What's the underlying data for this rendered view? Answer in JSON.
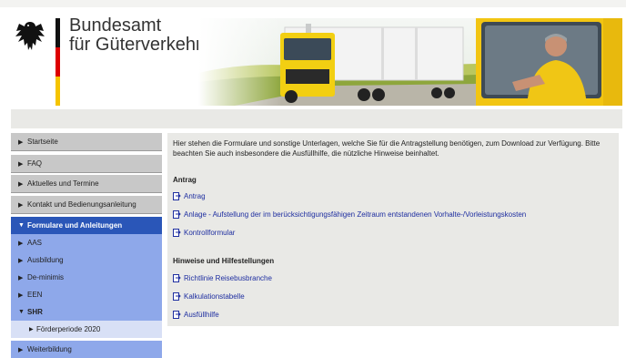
{
  "header": {
    "org_line1": "Bundesamt",
    "org_line2": "für Güterverkehr"
  },
  "nav": [
    {
      "label": "Startseite"
    },
    {
      "label": "FAQ"
    },
    {
      "label": "Aktuelles und Termine"
    },
    {
      "label": "Kontakt und Bedienungsanleitung"
    },
    {
      "label": "Formulare und Anleitungen"
    },
    {
      "label": "AAS"
    },
    {
      "label": "Ausbildung"
    },
    {
      "label": "De-minimis"
    },
    {
      "label": "EEN"
    },
    {
      "label": "SHR"
    },
    {
      "label": "Förderperiode 2020"
    },
    {
      "label": "Weiterbildung"
    }
  ],
  "content": {
    "intro": "Hier stehen die Formulare und sonstige Unterlagen, welche Sie für die Antragstellung benötigen, zum Download zur Verfügung. Bitte beachten Sie auch insbesondere die Ausfüllhilfe, die nützliche Hinweise beinhaltet.",
    "section1": "Antrag",
    "docs1": [
      "Antrag",
      "Anlage - Aufstellung der im berücksichtigungsfähigen Zeitraum entstandenen Vorhalte-/Vorleistungskosten",
      "Kontrollformular"
    ],
    "section2": "Hinweise und Hilfestellungen",
    "docs2": [
      "Richtlinie Reisebusbranche",
      "Kalkulationstabelle",
      "Ausfüllhilfe"
    ]
  },
  "colors": {
    "nav_active": "#2a56b8",
    "nav_sub": "#8ea8ea",
    "link": "#1e2ea0"
  }
}
